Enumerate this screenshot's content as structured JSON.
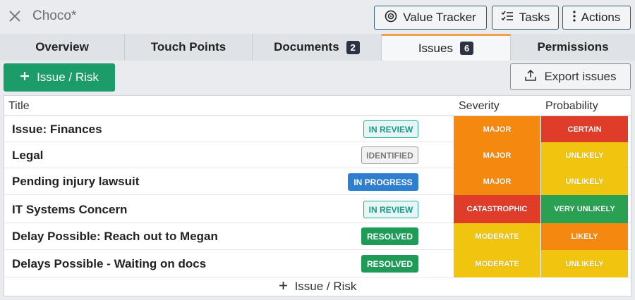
{
  "header": {
    "title": "Choco*"
  },
  "top_buttons": {
    "value_tracker": "Value Tracker",
    "tasks": "Tasks",
    "actions": "Actions"
  },
  "tabs": [
    {
      "label": "Overview",
      "badge": ""
    },
    {
      "label": "Touch Points",
      "badge": ""
    },
    {
      "label": "Documents",
      "badge": "2"
    },
    {
      "label": "Issues",
      "badge": "6"
    },
    {
      "label": "Permissions",
      "badge": ""
    }
  ],
  "toolbar": {
    "add_label": "Issue / Risk",
    "export_label": "Export issues"
  },
  "table": {
    "columns": {
      "title": "Title",
      "severity": "Severity",
      "probability": "Probability"
    },
    "rows": [
      {
        "title": "Issue: Finances",
        "status": "IN REVIEW",
        "severity": "MAJOR",
        "probability": "CERTAIN"
      },
      {
        "title": "Legal",
        "status": "IDENTIFIED",
        "severity": "MAJOR",
        "probability": "UNLIKELY"
      },
      {
        "title": "Pending injury lawsuit",
        "status": "IN PROGRESS",
        "severity": "MAJOR",
        "probability": "UNLIKELY"
      },
      {
        "title": "IT Systems Concern",
        "status": "IN REVIEW",
        "severity": "CATASTROPHIC",
        "probability": "VERY UNLIKELY"
      },
      {
        "title": "Delay Possible: Reach out to Megan",
        "status": "RESOLVED",
        "severity": "MODERATE",
        "probability": "LIKELY"
      },
      {
        "title": "Delays Possible - Waiting on docs",
        "status": "RESOLVED",
        "severity": "MODERATE",
        "probability": "UNLIKELY"
      }
    ],
    "footer_add_label": "Issue / Risk"
  },
  "colors": {
    "accent_green": "#1c9c68",
    "tab_active_border": "#f0a04b",
    "status_in_review": "#29a9a3",
    "status_identified": "#8a8a8a",
    "status_in_progress": "#2f7fd0",
    "status_resolved": "#1e9b57",
    "level_orange": "#f5880f",
    "level_red": "#e03c2a",
    "level_yellow": "#f1c40f",
    "level_green": "#2aa152"
  },
  "icons": {
    "close": "close-icon",
    "value_tracker": "target-icon",
    "tasks": "checklist-icon",
    "actions": "kebab-icon",
    "add": "plus-icon",
    "export": "upload-icon"
  }
}
